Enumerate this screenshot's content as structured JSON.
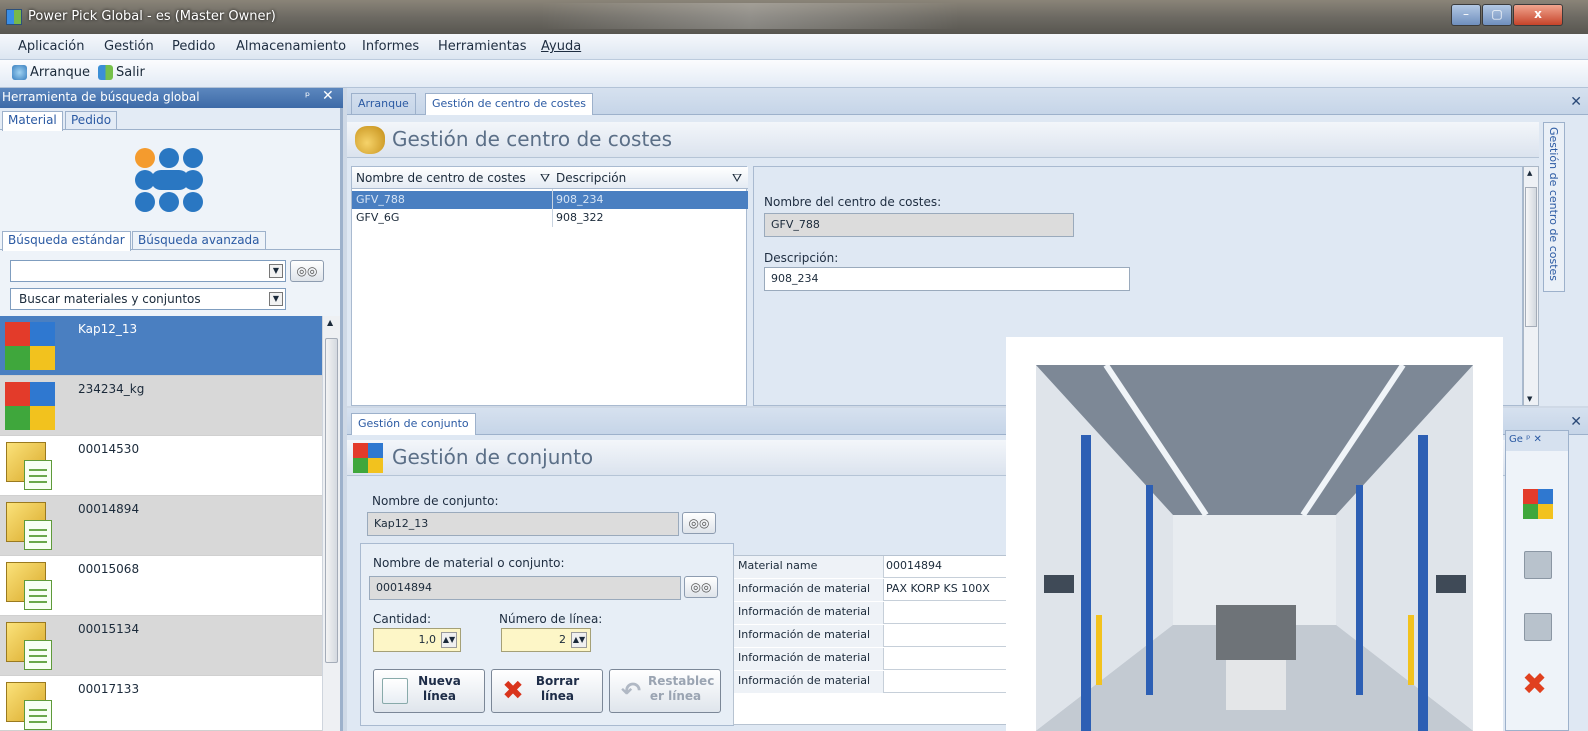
{
  "window": {
    "title": "Power Pick Global - es (Master Owner)",
    "minimize": "–",
    "maximize": "▢",
    "close": "x"
  },
  "menu": [
    "Aplicación",
    "Gestión",
    "Pedido",
    "Almacenamiento",
    "Informes",
    "Herramientas",
    "Ayuda"
  ],
  "toolbar": {
    "start_label": "Arranque",
    "exit_label": "Salir"
  },
  "search_panel": {
    "title": "Herramienta de búsqueda global",
    "pin": "ᵖ",
    "close": "✕",
    "tabs": [
      "Material",
      "Pedido"
    ],
    "search_tabs": [
      "Búsqueda estándar",
      "Búsqueda avanzada"
    ],
    "search_value": "",
    "search_scope": "Buscar materiales y conjuntos",
    "items": [
      {
        "label": "Kap12_13",
        "icon": "assembly-cube-icon"
      },
      {
        "label": "234234_kg",
        "icon": "assembly-cube-icon"
      },
      {
        "label": "00014530",
        "icon": "material-box-icon"
      },
      {
        "label": "00014894",
        "icon": "material-box-icon"
      },
      {
        "label": "00015068",
        "icon": "material-box-icon"
      },
      {
        "label": "00015134",
        "icon": "material-box-icon"
      },
      {
        "label": "00017133",
        "icon": "material-box-icon"
      }
    ]
  },
  "cost_center_doc": {
    "tabs": [
      "Arranque",
      "Gestión de centro de costes"
    ],
    "heading": "Gestión de centro de costes",
    "side_tab": "Gestión de centro de costes",
    "columns": [
      "Nombre de centro de costes",
      "Descripción"
    ],
    "rows": [
      {
        "name": "GFV_788",
        "desc": "908_234"
      },
      {
        "name": "GFV_6G",
        "desc": "908_322"
      }
    ],
    "name_label": "Nombre del centro de costes:",
    "name_value": "GFV_788",
    "desc_label": "Descripción:",
    "desc_value": "908_234"
  },
  "assembly_doc": {
    "tab": "Gestión de conjunto",
    "heading": "Gestión de conjunto",
    "assembly_name_label": "Nombre de conjunto:",
    "assembly_name_value": "Kap12_13",
    "material_label": "Nombre de material o conjunto:",
    "material_value": "00014894",
    "quantity_label": "Cantidad:",
    "quantity_value": "1,0",
    "line_label": "Número de línea:",
    "line_value": "2",
    "btn_new": [
      "Nueva",
      "línea"
    ],
    "btn_delete": [
      "Borrar",
      "línea"
    ],
    "btn_reset": [
      "Restablec",
      "er línea"
    ],
    "props": [
      {
        "k": "Material name",
        "v": "00014894"
      },
      {
        "k": "Información de material",
        "v": "PAX KORP KS 100X"
      },
      {
        "k": "Información de material",
        "v": ""
      },
      {
        "k": "Información de material",
        "v": ""
      },
      {
        "k": "Información de material",
        "v": ""
      },
      {
        "k": "Información de material",
        "v": ""
      }
    ],
    "side_header": "Ge ᵖ ✕"
  },
  "colors": {
    "accent": "#4a7fc1",
    "title_text": "#5b6f87",
    "selection": "#4a7fc1"
  }
}
